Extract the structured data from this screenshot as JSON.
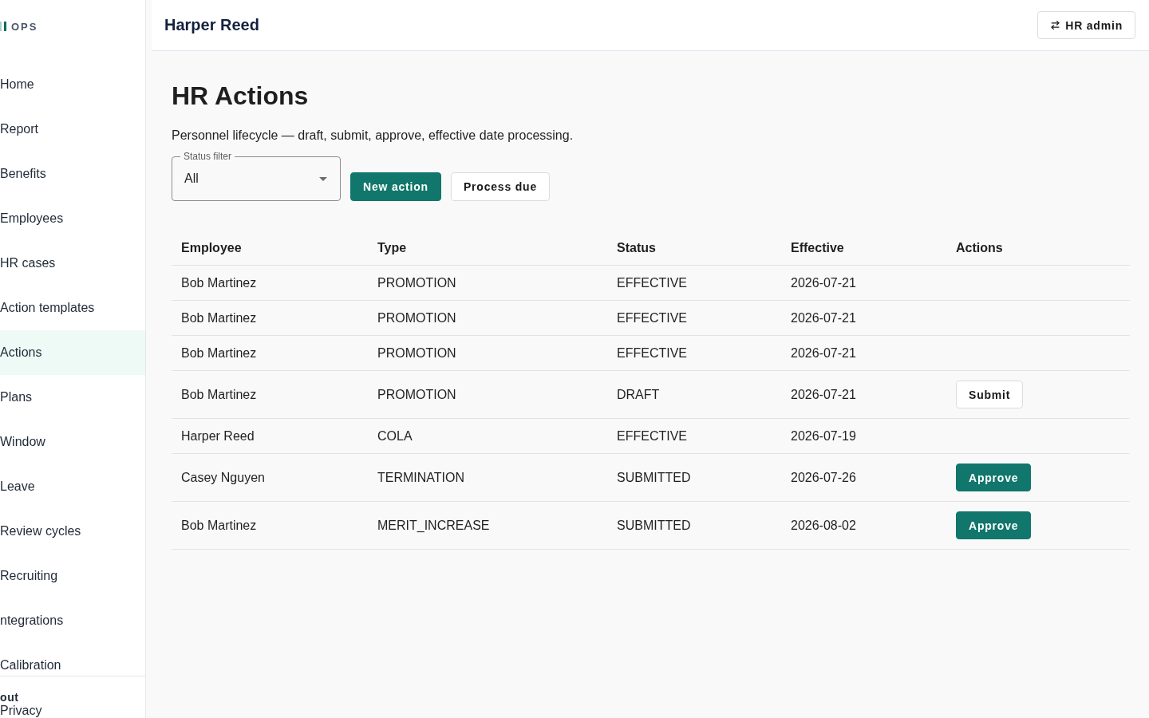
{
  "sidebar": {
    "logo": "OPS",
    "items": [
      {
        "label": "Home",
        "selected": false
      },
      {
        "label": "Report",
        "selected": false
      },
      {
        "label": "Benefits",
        "selected": false
      },
      {
        "label": "Employees",
        "selected": false
      },
      {
        "label": "HR cases",
        "selected": false
      },
      {
        "label": "Action templates",
        "selected": false
      },
      {
        "label": "Actions",
        "selected": true
      },
      {
        "label": "Plans",
        "selected": false
      },
      {
        "label": "Window",
        "selected": false
      },
      {
        "label": "Leave",
        "selected": false
      },
      {
        "label": "Review cycles",
        "selected": false
      },
      {
        "label": "Recruiting",
        "selected": false
      },
      {
        "label": "ntegrations",
        "selected": false
      },
      {
        "label": "Calibration",
        "selected": false
      }
    ],
    "footer": [
      {
        "label": "out",
        "kind": "strong"
      },
      {
        "label": "Privacy",
        "kind": "link"
      }
    ]
  },
  "header": {
    "title": "Harper Reed",
    "role_button": "HR admin"
  },
  "page": {
    "title": "HR Actions",
    "subtitle": "Personnel lifecycle — draft, submit, approve, effective date processing.",
    "status_filter": {
      "label": "Status filter",
      "value": "All"
    },
    "buttons": [
      {
        "label": "New action",
        "kind": "primary"
      },
      {
        "label": "Process due",
        "kind": "outline"
      }
    ]
  },
  "table": {
    "columns": [
      "Employee",
      "Type",
      "Status",
      "Effective",
      "Actions"
    ],
    "rows": [
      {
        "employee": "Bob Martinez",
        "type": "PROMOTION",
        "status": "EFFECTIVE",
        "effective": "2026-07-21"
      },
      {
        "employee": "Bob Martinez",
        "type": "PROMOTION",
        "status": "EFFECTIVE",
        "effective": "2026-07-21"
      },
      {
        "employee": "Bob Martinez",
        "type": "PROMOTION",
        "status": "EFFECTIVE",
        "effective": "2026-07-21"
      },
      {
        "employee": "Bob Martinez",
        "type": "PROMOTION",
        "status": "DRAFT",
        "effective": "2026-07-21",
        "action": {
          "label": "Submit",
          "kind": "outline"
        }
      },
      {
        "employee": "Harper Reed",
        "type": "COLA",
        "status": "EFFECTIVE",
        "effective": "2026-07-19"
      },
      {
        "employee": "Casey Nguyen",
        "type": "TERMINATION",
        "status": "SUBMITTED",
        "effective": "2026-07-26",
        "action": {
          "label": "Approve",
          "kind": "primary"
        }
      },
      {
        "employee": "Bob Martinez",
        "type": "MERIT_INCREASE",
        "status": "SUBMITTED",
        "effective": "2026-08-02",
        "action": {
          "label": "Approve",
          "kind": "primary"
        }
      }
    ]
  }
}
